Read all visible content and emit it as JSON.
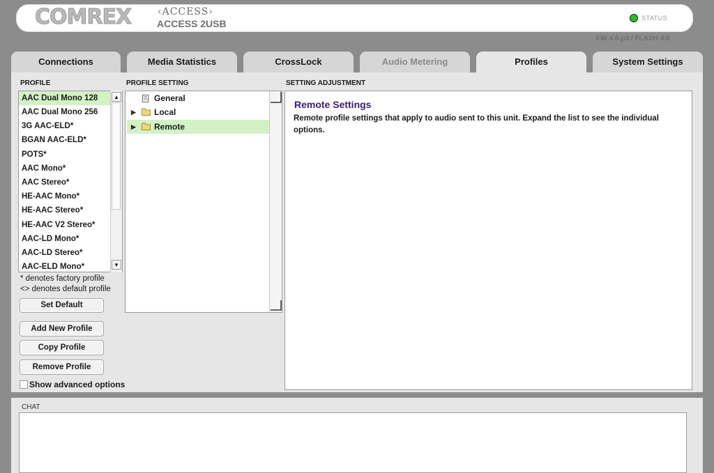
{
  "header": {
    "logo_text": "COMREX",
    "product_line": "‹ACCESS›",
    "model": "ACCESS 2USB",
    "status_label": "STATUS",
    "status_color": "#22c22a",
    "firmware": "FW 4.6-p3 / FLASH 4.0"
  },
  "tabs": [
    {
      "label": "Connections",
      "state": "normal"
    },
    {
      "label": "Media Statistics",
      "state": "normal"
    },
    {
      "label": "CrossLock",
      "state": "normal"
    },
    {
      "label": "Audio Metering",
      "state": "disabled"
    },
    {
      "label": "Profiles",
      "state": "active"
    },
    {
      "label": "System Settings",
      "state": "normal"
    }
  ],
  "profile": {
    "label": "PROFILE",
    "items": [
      "AAC Dual Mono 128",
      "AAC Dual Mono 256",
      "3G AAC-ELD*",
      "BGAN AAC-ELD*",
      "POTS*",
      "AAC Mono*",
      "AAC Stereo*",
      "HE-AAC Mono*",
      "HE-AAC Stereo*",
      "HE-AAC V2 Stereo*",
      "AAC-LD Mono*",
      "AAC-LD Stereo*",
      "AAC-ELD Mono*"
    ],
    "selected_index": 0,
    "note_factory": "* denotes factory profile",
    "note_default": "<> denotes default profile",
    "set_default_label": "Set Default",
    "add_label": "Add New Profile",
    "copy_label": "Copy Profile",
    "remove_label": "Remove Profile",
    "advanced_label": "Show advanced options",
    "advanced_checked": false
  },
  "profile_setting": {
    "label": "PROFILE SETTING",
    "items": [
      {
        "label": "General",
        "icon": "document-icon",
        "expandable": false
      },
      {
        "label": "Local",
        "icon": "folder-icon",
        "expandable": true
      },
      {
        "label": "Remote",
        "icon": "folder-icon",
        "expandable": true
      }
    ],
    "selected_index": 2
  },
  "adjustment": {
    "label": "SETTING ADJUSTMENT",
    "title": "Remote Settings",
    "description": "Remote profile settings that apply to audio sent to this unit.  Expand the list to see the individual options."
  },
  "chat": {
    "label": "CHAT"
  },
  "colors": {
    "selection": "#d2f2c6",
    "title_accent": "#3a1c7a"
  }
}
